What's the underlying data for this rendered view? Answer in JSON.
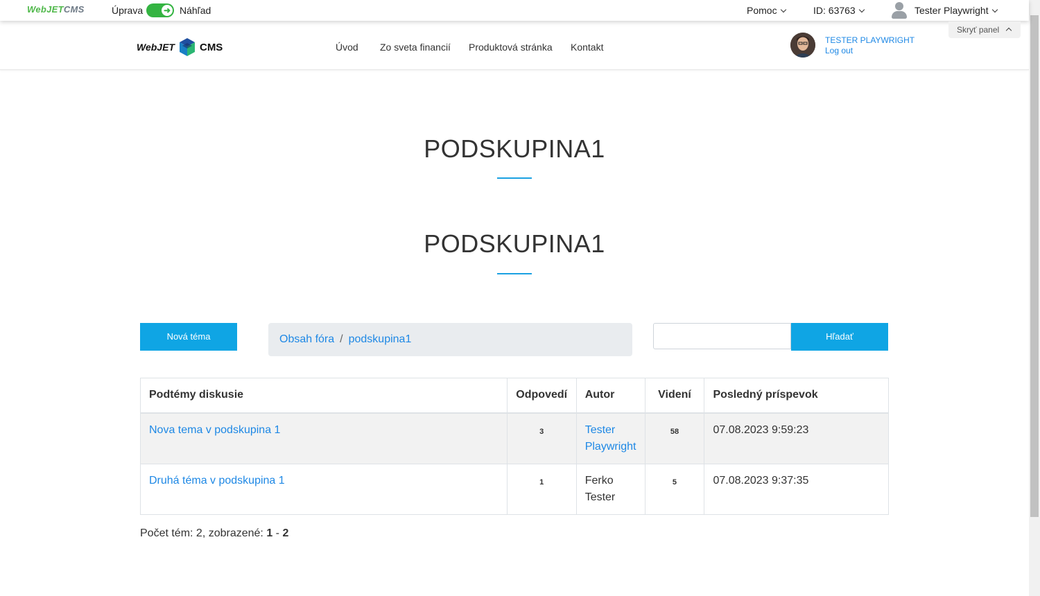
{
  "adminbar": {
    "logo_green": "WebJET",
    "logo_gray": "CMS",
    "mode_edit": "Úprava",
    "mode_preview": "Náhľad",
    "help": "Pomoc",
    "doc_id": "ID: 63763",
    "user": "Tester Playwright",
    "hide_panel": "Skryť panel"
  },
  "site": {
    "logo_left": "WebJET",
    "logo_right": "CMS",
    "nav": [
      "Úvod",
      "Zo sveta financií",
      "Produktová stránka",
      "Kontakt"
    ],
    "user_name": "TESTER PLAYWRIGHT",
    "logout": "Log out"
  },
  "headings": {
    "page_title": "PODSKUPINA1",
    "forum_title": "PODSKUPINA1"
  },
  "forum": {
    "new_topic": "Nová téma",
    "breadcrumb": [
      "Obsah fóra",
      "podskupina1"
    ],
    "search_value": "",
    "search_button": "Hľadať",
    "columns": [
      "Podtémy diskusie",
      "Odpovedí",
      "Autor",
      "Videní",
      "Posledný príspevok"
    ],
    "rows": [
      {
        "topic": "Nova tema v podskupina 1",
        "replies": "3",
        "author_line1": "Tester",
        "author_line2": "Playwright",
        "author_link": true,
        "views": "58",
        "last_post": "07.08.2023 9:59:23"
      },
      {
        "topic": "Druhá téma v podskupina 1",
        "replies": "1",
        "author_line1": "Ferko",
        "author_line2": "Tester",
        "author_link": false,
        "views": "5",
        "last_post": "07.08.2023 9:37:35"
      }
    ],
    "count_text": "Počet tém: 2, zobrazené: ",
    "count_from": "1",
    "count_sep": " - ",
    "count_to": "2"
  },
  "colors": {
    "accent": "#0fa5e4",
    "link": "#1e88e5",
    "toggle": "#34b442"
  }
}
